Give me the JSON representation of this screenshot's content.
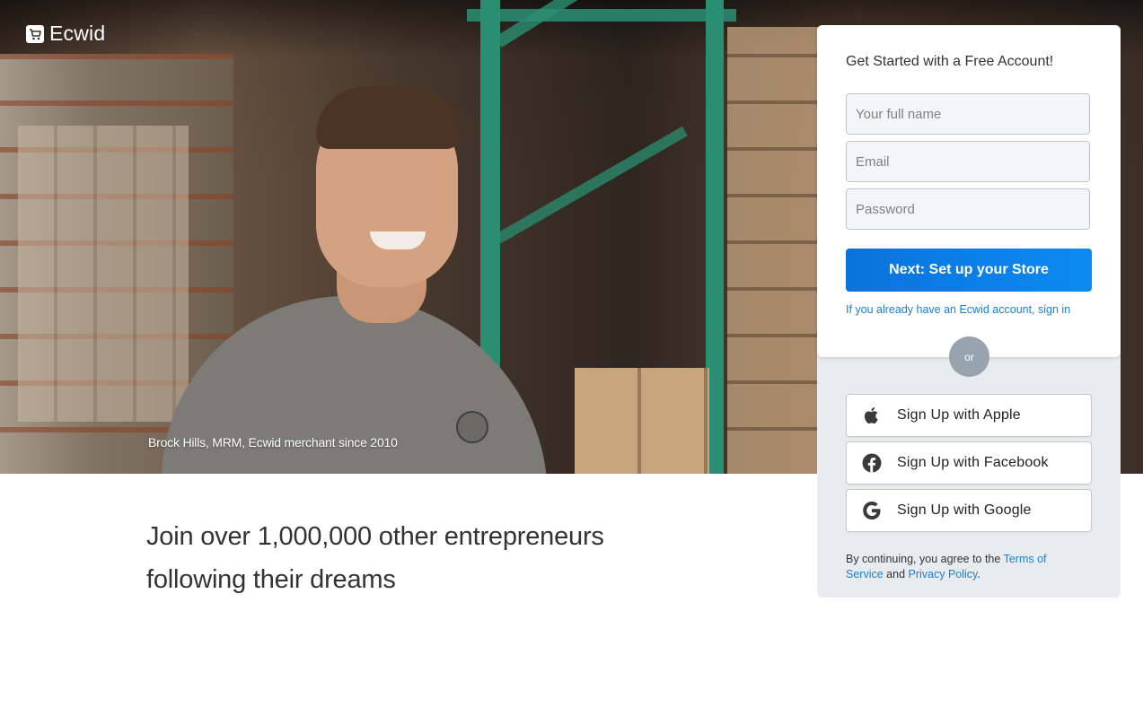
{
  "brand": {
    "name": "Ecwid",
    "icon": "cart-icon"
  },
  "hero": {
    "caption": "Brock Hills, MRM, Ecwid merchant since 2010"
  },
  "tagline": "Join over 1,000,000 other entrepreneurs following their dreams",
  "signup": {
    "title": "Get Started with a Free Account!",
    "name_placeholder": "Your full name",
    "email_placeholder": "Email",
    "password_placeholder": "Password",
    "submit_label": "Next: Set up your Store",
    "signin_text": "If you already have an Ecwid account, sign in"
  },
  "divider": {
    "or": "or"
  },
  "social": [
    {
      "label": "Sign Up with Apple",
      "icon": "apple-icon"
    },
    {
      "label": "Sign Up with Facebook",
      "icon": "facebook-icon"
    },
    {
      "label": "Sign Up with Google",
      "icon": "google-icon"
    }
  ],
  "terms": {
    "prefix": "By continuing, you agree to the",
    "terms_link": "Terms of Service",
    "and": "and",
    "privacy_link": "Privacy Policy",
    "suffix": "."
  },
  "colors": {
    "accent": "#0b7fe6",
    "link": "#1a7fd4",
    "panel": "#e9ecef"
  }
}
